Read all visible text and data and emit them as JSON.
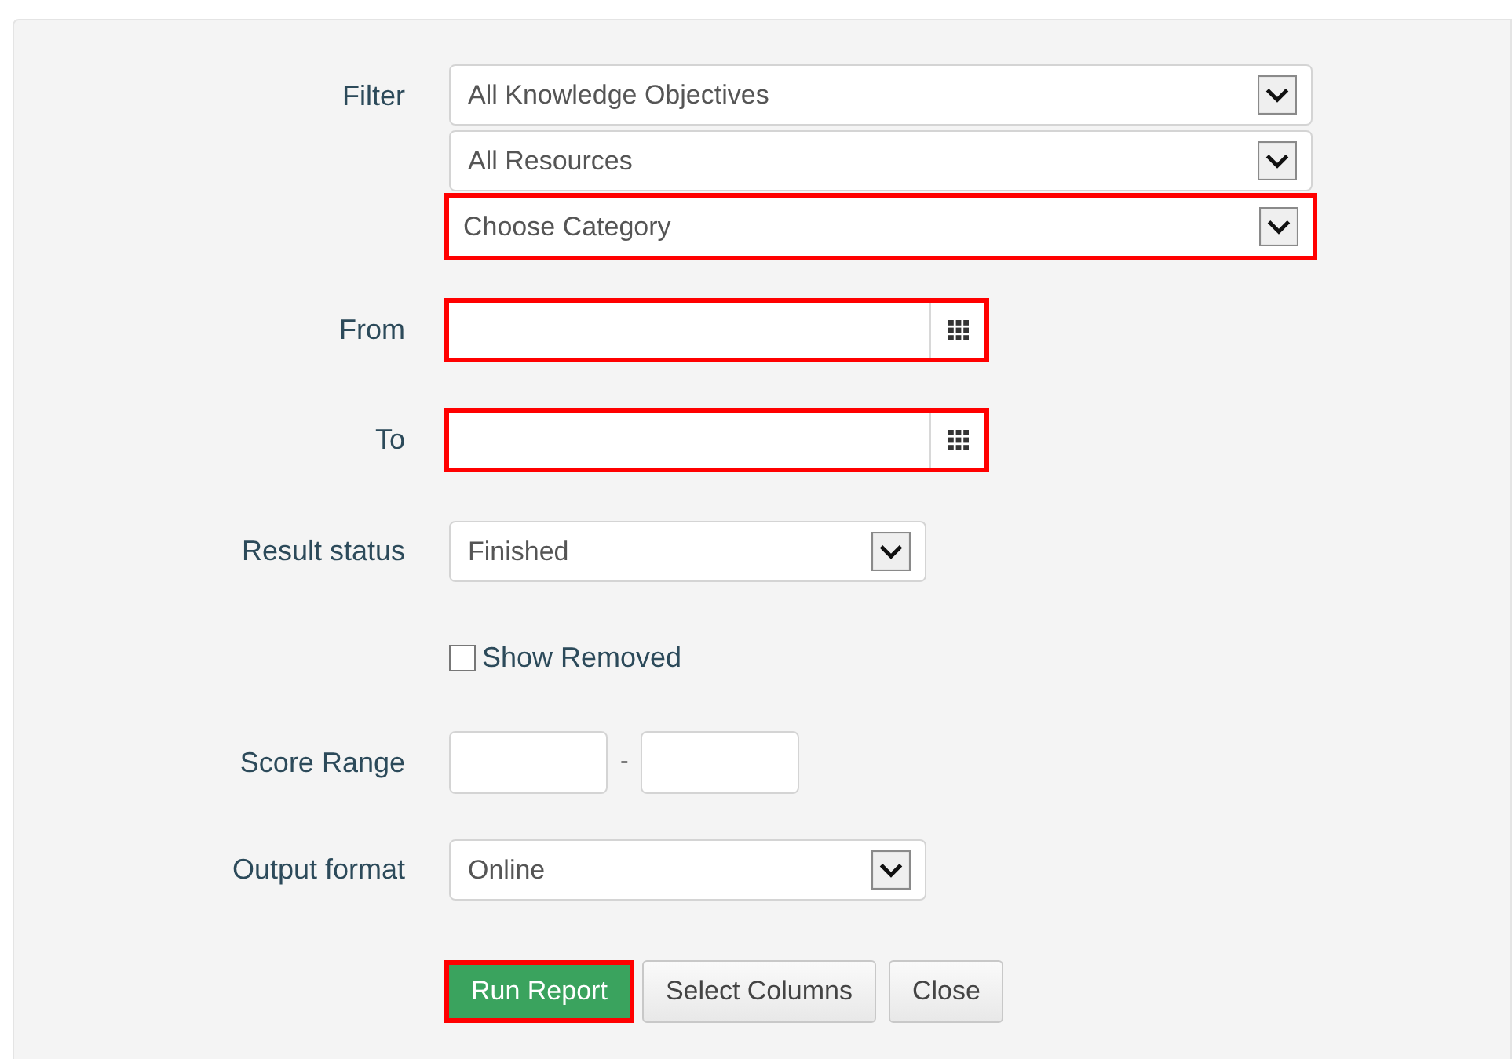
{
  "filter": {
    "label": "Filter",
    "selects": [
      {
        "value": "All Knowledge Objectives",
        "highlighted": false
      },
      {
        "value": "All Resources",
        "highlighted": false
      },
      {
        "value": "Choose Category",
        "highlighted": true
      }
    ]
  },
  "rows": [
    {
      "kind": "date",
      "label": "From",
      "highlighted": true
    },
    {
      "kind": "date",
      "label": "To",
      "highlighted": true
    },
    {
      "kind": "select",
      "label": "Result status",
      "value": "Finished",
      "highlighted": false
    },
    {
      "kind": "checkbox",
      "text": "Show Removed",
      "checked": false
    },
    {
      "kind": "range",
      "label": "Score Range",
      "separator": "-"
    },
    {
      "kind": "select",
      "label": "Output format",
      "value": "Online",
      "highlighted": false
    }
  ],
  "buttons": [
    {
      "label": "Run Report",
      "kind": "primary",
      "highlighted": true
    },
    {
      "label": "Select Columns",
      "kind": "default",
      "highlighted": false
    },
    {
      "label": "Close",
      "kind": "default",
      "highlighted": false
    }
  ]
}
